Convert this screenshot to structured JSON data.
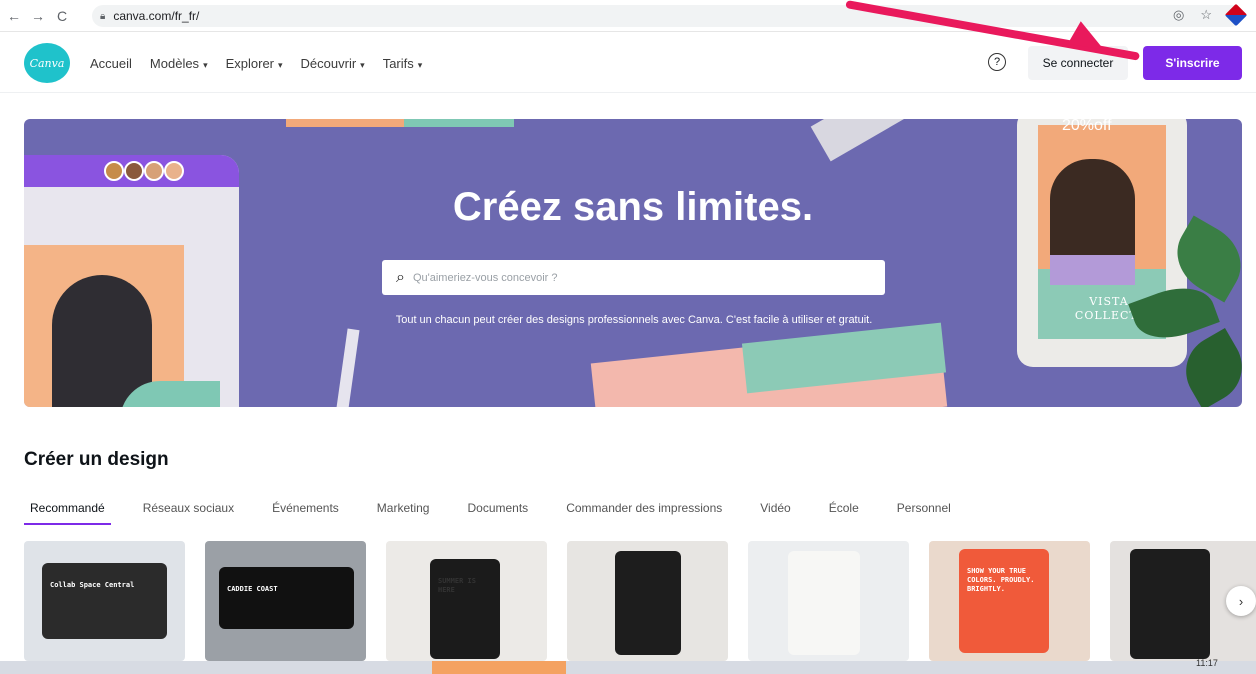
{
  "browser": {
    "url": "canva.com/fr_fr/",
    "back_glyph": "←",
    "forward_glyph": "→",
    "reload_glyph": "C"
  },
  "header": {
    "logo_text": "Canva",
    "nav": [
      {
        "label": "Accueil",
        "has_chevron": false
      },
      {
        "label": "Modèles",
        "has_chevron": true
      },
      {
        "label": "Explorer",
        "has_chevron": true
      },
      {
        "label": "Découvrir",
        "has_chevron": true
      },
      {
        "label": "Tarifs",
        "has_chevron": true
      }
    ],
    "help_glyph": "?",
    "login_label": "Se connecter",
    "signup_label": "S'inscrire"
  },
  "hero": {
    "title": "Créez sans limites.",
    "search_placeholder": "Qu'aimeriez-vous concevoir ?",
    "subtitle": "Tout un chacun peut créer des designs professionnels avec Canva. C'est facile à utiliser et gratuit.",
    "promo_text": "20%off",
    "collection_text": "VISTA COLLECTI"
  },
  "create": {
    "title": "Créer un design",
    "tabs": [
      {
        "label": "Recommandé",
        "active": true
      },
      {
        "label": "Réseaux sociaux",
        "active": false
      },
      {
        "label": "Événements",
        "active": false
      },
      {
        "label": "Marketing",
        "active": false
      },
      {
        "label": "Documents",
        "active": false
      },
      {
        "label": "Commander des impressions",
        "active": false
      },
      {
        "label": "Vidéo",
        "active": false
      },
      {
        "label": "École",
        "active": false
      },
      {
        "label": "Personnel",
        "active": false
      }
    ],
    "cards": [
      {
        "label": "Collab Space Central",
        "bg": "#dfe3e8"
      },
      {
        "label": "CADDIE COAST",
        "bg": "#9ba0a6"
      },
      {
        "label": "SUMMER IS HERE",
        "bg": "#eceae7"
      },
      {
        "label": "",
        "bg": "#e7e5e2"
      },
      {
        "label": "",
        "bg": "#eceef0"
      },
      {
        "label": "SHOW YOUR TRUE COLORS. PROUDLY. BRIGHTLY.",
        "bg": "#ead9cc"
      },
      {
        "label": "",
        "bg": "#e4e1df"
      }
    ],
    "next_glyph": "›"
  },
  "taskbar": {
    "clock": "11:17"
  },
  "colors": {
    "brand_purple": "#7d2ae8",
    "brand_teal": "#1fc2cb",
    "hero_bg": "#6c69b0",
    "annotation_arrow": "#e9195c"
  }
}
